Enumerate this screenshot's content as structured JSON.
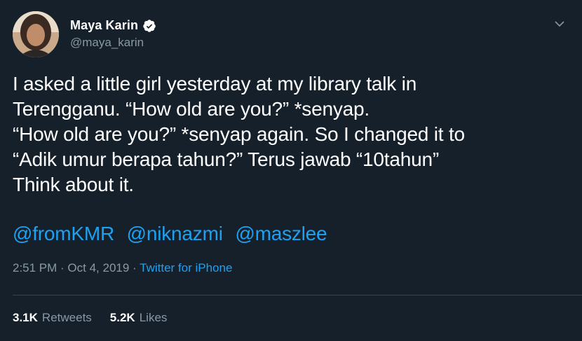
{
  "colors": {
    "background": "#15202b",
    "text": "#ffffff",
    "secondary_text": "#8899a6",
    "link": "#1da1f2",
    "divider": "#38444d",
    "verified_badge": "#ffffff"
  },
  "author": {
    "display_name": "Maya Karin",
    "handle": "@maya_karin",
    "verified": true,
    "avatar_icon": "profile-photo"
  },
  "header": {
    "menu_icon": "chevron-down-icon"
  },
  "tweet": {
    "text": "I asked a little girl yesterday at my library talk in\nTerengganu. “How old are you?” *senyap.\n“How old are you?” *senyap again. So I changed it to\n“Adik umur berapa tahun?” Terus jawab “10tahun”\nThink about it.",
    "mentions": [
      "@fromKMR",
      "@niknazmi",
      "@maszlee"
    ]
  },
  "meta": {
    "time": "2:51 PM",
    "separator1": " · ",
    "date": "Oct 4, 2019",
    "separator2": " · ",
    "source": "Twitter for iPhone"
  },
  "stats": {
    "retweets_count": "3.1K",
    "retweets_label": "Retweets",
    "likes_count": "5.2K",
    "likes_label": "Likes"
  }
}
